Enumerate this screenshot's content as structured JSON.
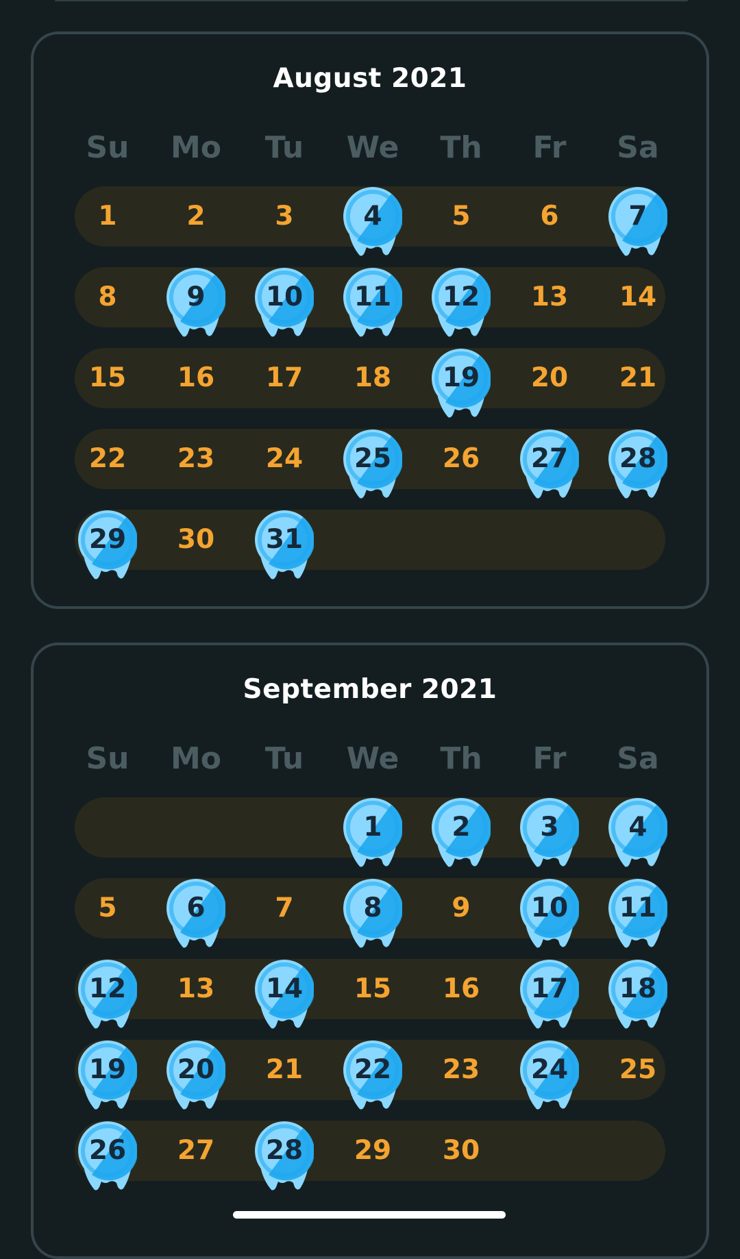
{
  "weekday_labels": [
    "Su",
    "Mo",
    "Tu",
    "We",
    "Th",
    "Fr",
    "Sa"
  ],
  "colors": {
    "background": "#141e21",
    "card_border": "#35454b",
    "week_pill": "#292a1d",
    "day_number": "#f5a431",
    "weekday_label": "#4c5d62",
    "marker_light": "#8ad8ff",
    "marker_dark": "#1ea7ee",
    "marker_text": "#15293a"
  },
  "months": [
    {
      "title": "August 2021",
      "weeks": [
        [
          1,
          2,
          3,
          4,
          5,
          6,
          7
        ],
        [
          8,
          9,
          10,
          11,
          12,
          13,
          14
        ],
        [
          15,
          16,
          17,
          18,
          19,
          20,
          21
        ],
        [
          22,
          23,
          24,
          25,
          26,
          27,
          28
        ],
        [
          29,
          30,
          31,
          null,
          null,
          null,
          null
        ]
      ],
      "marked_days": [
        4,
        7,
        9,
        10,
        11,
        12,
        19,
        25,
        27,
        28,
        29,
        31
      ]
    },
    {
      "title": "September 2021",
      "weeks": [
        [
          null,
          null,
          null,
          1,
          2,
          3,
          4
        ],
        [
          5,
          6,
          7,
          8,
          9,
          10,
          11
        ],
        [
          12,
          13,
          14,
          15,
          16,
          17,
          18
        ],
        [
          19,
          20,
          21,
          22,
          23,
          24,
          25
        ],
        [
          26,
          27,
          28,
          29,
          30,
          null,
          null
        ]
      ],
      "marked_days": [
        1,
        2,
        3,
        4,
        6,
        8,
        10,
        11,
        12,
        14,
        17,
        18,
        19,
        20,
        22,
        24,
        26,
        28
      ]
    }
  ]
}
